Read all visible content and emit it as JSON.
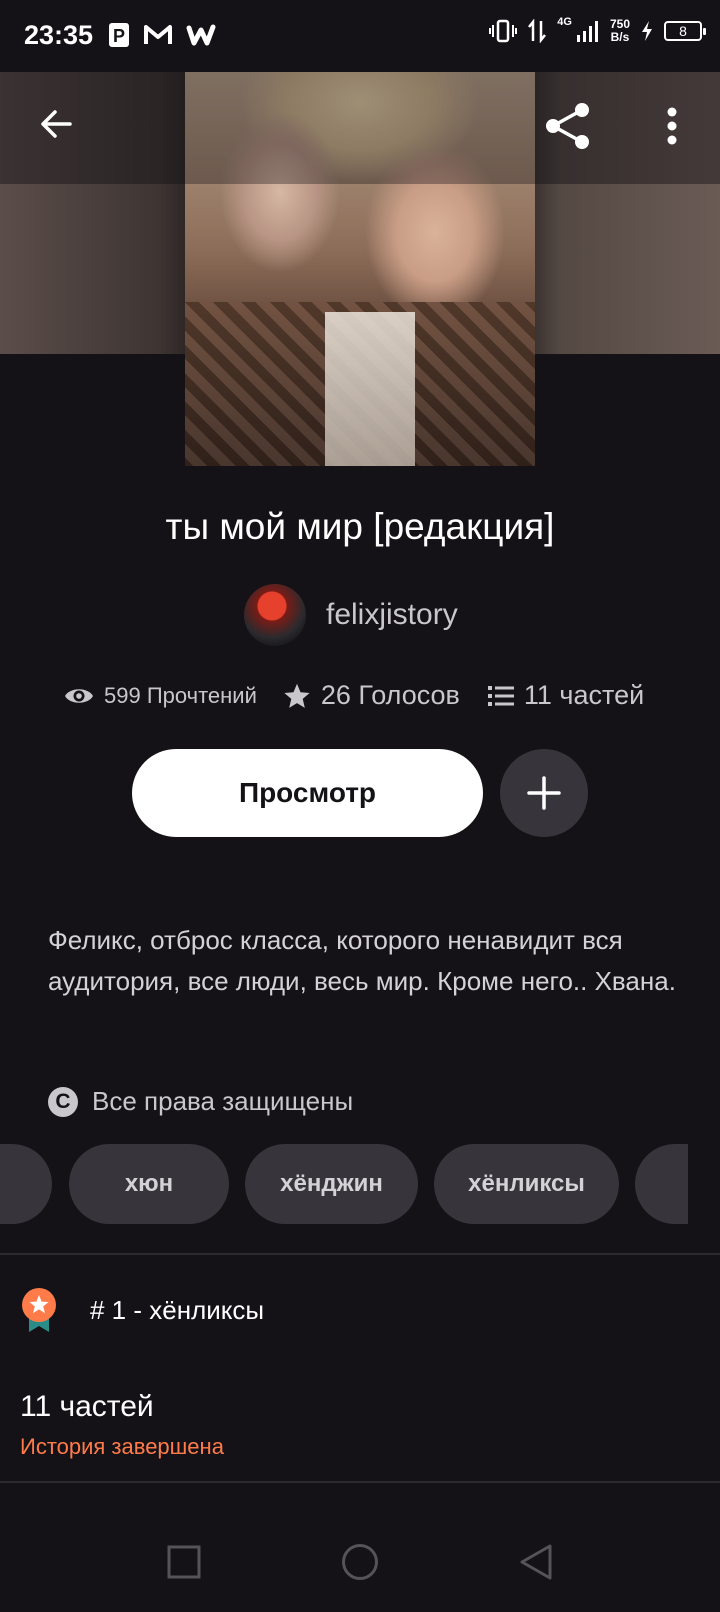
{
  "status_bar": {
    "time": "23:35",
    "net_type": "4G",
    "net_speed_value": "750",
    "net_speed_unit": "B/s",
    "battery": "8",
    "apps": [
      "parking-icon",
      "gmail-icon",
      "wattpad-icon"
    ]
  },
  "story": {
    "title": "ты мой мир [редакция]",
    "author": "felixjistory",
    "reads": "599 Прочтений",
    "votes": "26 Голосов",
    "parts": "11 частей",
    "read_button": "Просмотр",
    "description": "Феликс, отброс класса, которого ненавидит вся аудитория, все люди, весь мир. Кроме него.. Хвана.",
    "copyright": "Все права защищены",
    "tags": [
      "хюн",
      "хёнджин",
      "хёнликсы"
    ],
    "rank": "# 1 - хёнликсы",
    "parts_count": "11 частей",
    "status": "История завершена"
  },
  "colors": {
    "background": "#141216",
    "accent": "#ff7b4a",
    "chip": "#37353b",
    "button": "#ffffff"
  }
}
